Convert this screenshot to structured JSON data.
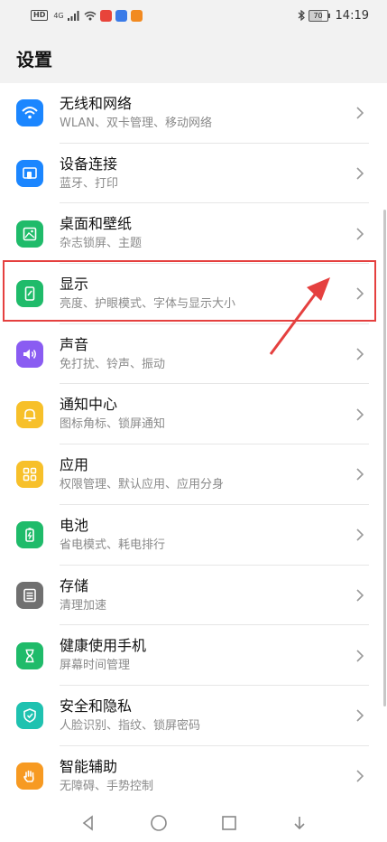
{
  "status_bar": {
    "hd": "HD",
    "network": "4G",
    "battery": "70",
    "time": "14:19"
  },
  "page": {
    "title": "设置"
  },
  "items": [
    {
      "title": "无线和网络",
      "subtitle": "WLAN、双卡管理、移动网络",
      "icon": "wifi-icon",
      "color": "#1b86ff"
    },
    {
      "title": "设备连接",
      "subtitle": "蓝牙、打印",
      "icon": "device-connect-icon",
      "color": "#1b86ff"
    },
    {
      "title": "桌面和壁纸",
      "subtitle": "杂志锁屏、主题",
      "icon": "wallpaper-icon",
      "color": "#1fbb6a"
    },
    {
      "title": "显示",
      "subtitle": "亮度、护眼模式、字体与显示大小",
      "icon": "display-icon",
      "color": "#1fbb6a"
    },
    {
      "title": "声音",
      "subtitle": "免打扰、铃声、振动",
      "icon": "sound-icon",
      "color": "#8a5cf2"
    },
    {
      "title": "通知中心",
      "subtitle": "图标角标、锁屏通知",
      "icon": "bell-icon",
      "color": "#f7c02a"
    },
    {
      "title": "应用",
      "subtitle": "权限管理、默认应用、应用分身",
      "icon": "apps-icon",
      "color": "#f7c02a"
    },
    {
      "title": "电池",
      "subtitle": "省电模式、耗电排行",
      "icon": "battery-icon",
      "color": "#1fbb6a"
    },
    {
      "title": "存储",
      "subtitle": "清理加速",
      "icon": "storage-icon",
      "color": "#707070"
    },
    {
      "title": "健康使用手机",
      "subtitle": "屏幕时间管理",
      "icon": "hourglass-icon",
      "color": "#1fbb6a"
    },
    {
      "title": "安全和隐私",
      "subtitle": "人脸识别、指纹、锁屏密码",
      "icon": "shield-icon",
      "color": "#1fc2b0"
    },
    {
      "title": "智能辅助",
      "subtitle": "无障碍、手势控制",
      "icon": "hand-icon",
      "color": "#f79a22"
    }
  ],
  "colors": {
    "highlight": "#e5403f",
    "arrow": "#e5403f"
  }
}
